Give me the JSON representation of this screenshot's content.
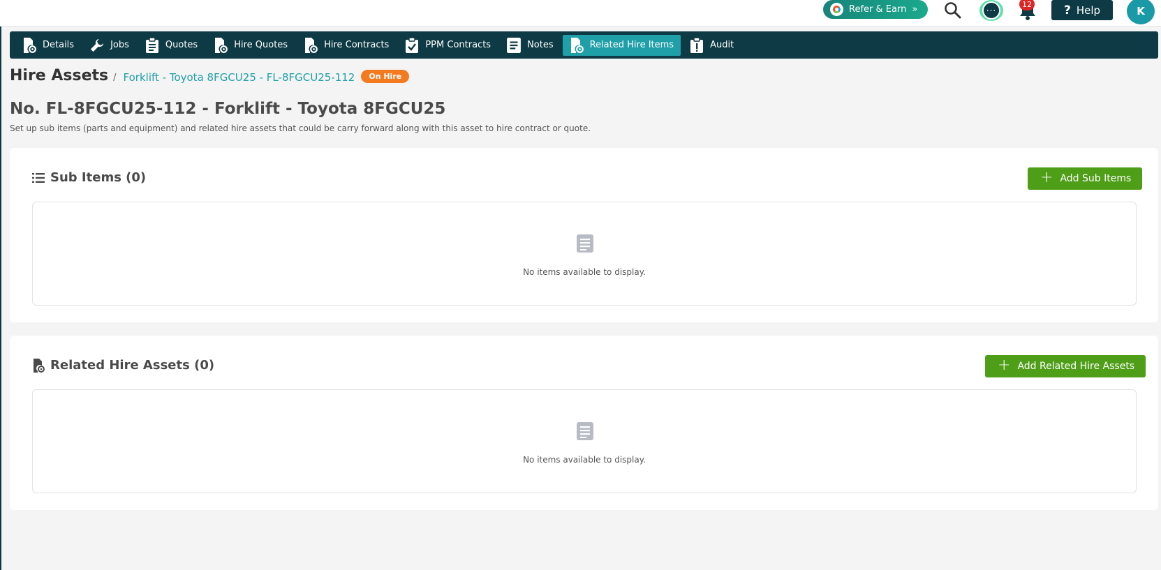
{
  "topbar": {
    "refer_label": "Refer & Earn",
    "refer_arrow": "»",
    "notification_count": "12",
    "help_label": "Help",
    "help_glyph": "?",
    "avatar_initial": "K",
    "chat_glyph": "···"
  },
  "nav": {
    "tabs": [
      {
        "label": "Details",
        "icon": "file-gear-icon",
        "active": false
      },
      {
        "label": "Jobs",
        "icon": "wrench-icon",
        "active": false
      },
      {
        "label": "Quotes",
        "icon": "clipboard-icon",
        "active": false
      },
      {
        "label": "Hire Quotes",
        "icon": "file-gear-icon",
        "active": false
      },
      {
        "label": "Hire Contracts",
        "icon": "file-gear-icon",
        "active": false
      },
      {
        "label": "PPM Contracts",
        "icon": "clipboard-check-icon",
        "active": false
      },
      {
        "label": "Notes",
        "icon": "notes-icon",
        "active": false
      },
      {
        "label": "Related Hire Items",
        "icon": "file-gear-icon",
        "active": true
      },
      {
        "label": "Audit",
        "icon": "clipboard-alert-icon",
        "active": false
      }
    ]
  },
  "header": {
    "breadcrumb_root": "Hire Assets",
    "breadcrumb_sep": "/",
    "breadcrumb_current": "Forklift - Toyota 8FGCU25 - FL-8FGCU25-112",
    "status": "On Hire",
    "title": "No. FL-8FGCU25-112 - Forklift - Toyota 8FGCU25",
    "description": "Set up sub items (parts and equipment) and related hire assets that could be carry forward along with this asset to hire contract or quote."
  },
  "sub_items": {
    "title": "Sub Items (0)",
    "add_label": "Add Sub Items",
    "empty_text": "No items available to display."
  },
  "related_assets": {
    "title": "Related Hire Assets (0)",
    "add_label": "Add Related Hire Assets",
    "empty_text": "No items available to display."
  },
  "colors": {
    "navy": "#0d3a44",
    "teal": "#1f9fa8",
    "green": "#4e9e17",
    "orange": "#f47a20"
  }
}
